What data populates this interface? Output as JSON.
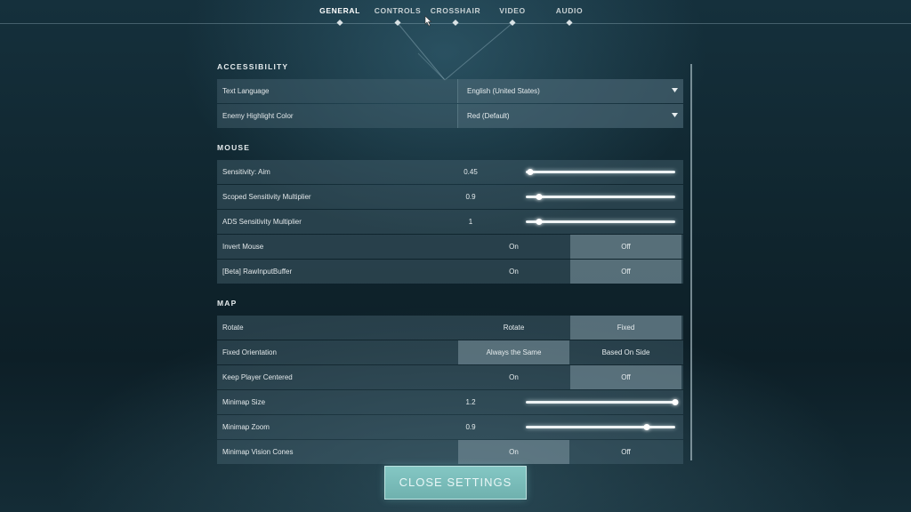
{
  "nav": {
    "tabs": [
      {
        "label": "GENERAL"
      },
      {
        "label": "CONTROLS"
      },
      {
        "label": "CROSSHAIR"
      },
      {
        "label": "VIDEO"
      },
      {
        "label": "AUDIO"
      }
    ],
    "active_tab": "GENERAL"
  },
  "sections": {
    "accessibility": {
      "title": "ACCESSIBILITY",
      "text_language": {
        "label": "Text Language",
        "value": "English (United States)"
      },
      "enemy_highlight": {
        "label": "Enemy Highlight Color",
        "value": "Red (Default)"
      }
    },
    "mouse": {
      "title": "MOUSE",
      "sensitivity_aim": {
        "label": "Sensitivity: Aim",
        "value": "0.45",
        "fill_fraction": 0.03
      },
      "scoped_multiplier": {
        "label": "Scoped Sensitivity Multiplier",
        "value": "0.9",
        "fill_fraction": 0.09
      },
      "ads_multiplier": {
        "label": "ADS Sensitivity Multiplier",
        "value": "1",
        "fill_fraction": 0.09
      },
      "invert_mouse": {
        "label": "Invert Mouse",
        "on": "On",
        "off": "Off",
        "selected": "off"
      },
      "raw_input": {
        "label": "[Beta] RawInputBuffer",
        "on": "On",
        "off": "Off",
        "selected": "off"
      }
    },
    "map": {
      "title": "MAP",
      "rotate": {
        "label": "Rotate",
        "left": "Rotate",
        "right": "Fixed",
        "selected": "right"
      },
      "fixed_orientation": {
        "label": "Fixed Orientation",
        "left": "Always the Same",
        "right": "Based On Side",
        "selected": "left"
      },
      "keep_centered": {
        "label": "Keep Player Centered",
        "on": "On",
        "off": "Off",
        "selected": "off"
      },
      "minimap_size": {
        "label": "Minimap Size",
        "value": "1.2",
        "fill_fraction": 1.0
      },
      "minimap_zoom": {
        "label": "Minimap Zoom",
        "value": "0.9",
        "fill_fraction": 0.81
      },
      "vision_cones": {
        "label": "Minimap Vision Cones",
        "on": "On",
        "off": "Off",
        "selected": "on"
      }
    }
  },
  "close_button": {
    "label": "CLOSE SETTINGS"
  },
  "colors": {
    "accent": "#78bcb9",
    "text": "#e6ecee"
  }
}
